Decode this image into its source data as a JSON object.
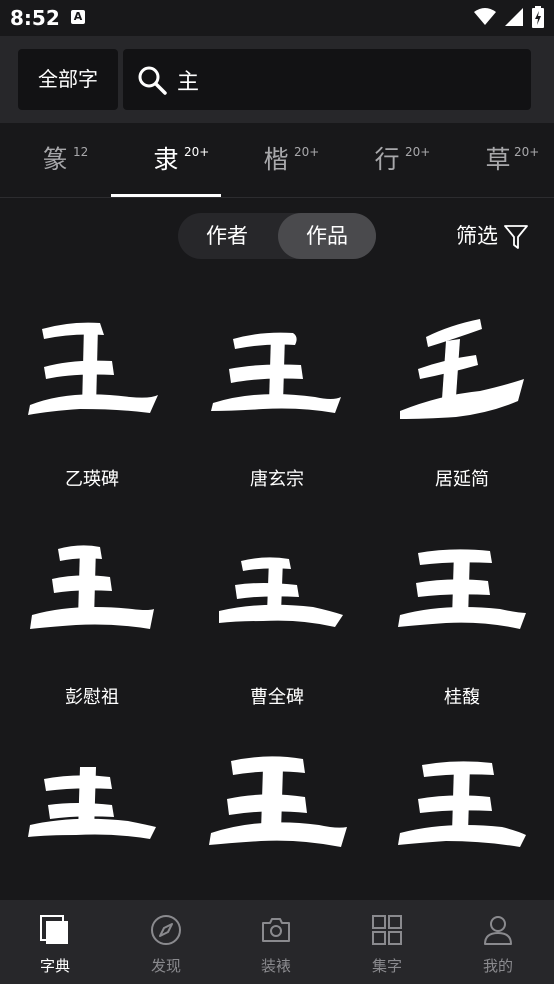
{
  "status_bar": {
    "time": "8:52",
    "notification": "A"
  },
  "search": {
    "scope_label": "全部字",
    "query": "主"
  },
  "tabs": [
    {
      "char": "篆",
      "count": "12",
      "active": false
    },
    {
      "char": "隶",
      "count": "20+",
      "active": true
    },
    {
      "char": "楷",
      "count": "20+",
      "active": false
    },
    {
      "char": "行",
      "count": "20+",
      "active": false
    },
    {
      "char": "草",
      "count": "20+",
      "active": false
    }
  ],
  "toggle": {
    "author_label": "作者",
    "works_label": "作品",
    "selected": "作品"
  },
  "filter": {
    "label": "筛选"
  },
  "results": [
    {
      "source": "乙瑛碑"
    },
    {
      "source": "唐玄宗"
    },
    {
      "source": "居延简"
    },
    {
      "source": "彭慰祖"
    },
    {
      "source": "曹全碑"
    },
    {
      "source": "桂馥"
    },
    {
      "source": ""
    },
    {
      "source": ""
    },
    {
      "source": ""
    }
  ],
  "bottom_nav": [
    {
      "label": "字典",
      "icon": "dictionary-icon",
      "active": true
    },
    {
      "label": "发现",
      "icon": "compass-icon",
      "active": false
    },
    {
      "label": "装裱",
      "icon": "camera-icon",
      "active": false
    },
    {
      "label": "集字",
      "icon": "grid-icon",
      "active": false
    },
    {
      "label": "我的",
      "icon": "person-icon",
      "active": false
    }
  ]
}
